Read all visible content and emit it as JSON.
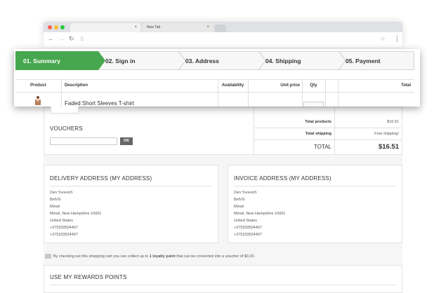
{
  "browser": {
    "tabs": [
      {
        "label": ""
      },
      {
        "label": "New Tab"
      }
    ],
    "close_glyph": "×"
  },
  "steps": [
    {
      "label": "01. Summary"
    },
    {
      "label": "02. Sign in"
    },
    {
      "label": "03. Address"
    },
    {
      "label": "04. Shipping"
    },
    {
      "label": "05. Payment"
    }
  ],
  "cart_table": {
    "headers": [
      "Product",
      "Description",
      "Availability",
      "Unit price",
      "Qty",
      "Total"
    ],
    "product_name": "Faded Short Sleeves T-shirt"
  },
  "vouchers": {
    "title": "VOUCHERS",
    "ok_label": "OK"
  },
  "totals": {
    "products_label": "Total products",
    "products_value": "$16.51",
    "shipping_label": "Total shipping",
    "shipping_value": "Free shipping!",
    "total_label": "TOTAL",
    "total_value": "$16.51"
  },
  "delivery": {
    "title": "DELIVERY ADDRESS (MY ADDRESS)",
    "lines": [
      "Den Yurevich",
      "BelVG",
      "Minsk",
      "Minsk, New Hampshire 10001",
      "United States",
      "+375333524407",
      "+375333524407"
    ]
  },
  "invoice": {
    "title": "INVOICE ADDRESS (MY ADDRESS)",
    "lines": [
      "Den Yurevich",
      "BelVG",
      "Minsk",
      "Minsk, New Hampshire 10001",
      "United States",
      "+375333524407",
      "+375333524407"
    ]
  },
  "loyalty": {
    "prefix": "By checking out this shopping cart you can collect up to",
    "points": "1 loyalty point",
    "suffix": "that can be converted into a voucher of $0.20."
  },
  "rewards": {
    "title": "USE MY REWARDS POINTS"
  },
  "colors": {
    "accent_green": "#46a74e",
    "ok_button": "#666666"
  }
}
